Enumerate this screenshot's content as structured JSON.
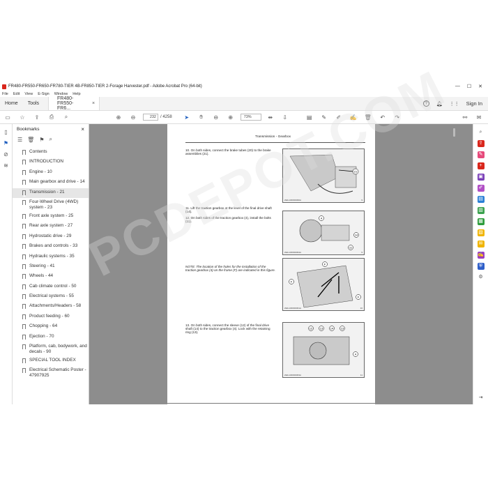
{
  "window": {
    "title": "FR480-FR550-FR650-FR780-TIER 4B-FR850-TIER 2-Forage Harvester.pdf - Adobe Acrobat Pro (64-bit)",
    "controls": [
      "—",
      "☐",
      "✕"
    ]
  },
  "menu": [
    "File",
    "Edit",
    "View",
    "E-Sign",
    "Window",
    "Help"
  ],
  "tabs": {
    "home": "Home",
    "tools": "Tools",
    "document": "FR480-FR550-FR6...",
    "close": "×",
    "help": "?",
    "sign_in": "Sign In"
  },
  "toolbar": {
    "page_current": "232",
    "page_total": "/ 4258",
    "zoom": "73%"
  },
  "bookmarks": {
    "title": "Bookmarks",
    "close": "×",
    "selected_index": 4,
    "items": [
      "Contents",
      "INTRODUCTION",
      "Engine - 10",
      "Main gearbox and drive - 14",
      "Transmission - 21",
      "Four-Wheel Drive (4WD) system - 23",
      "Front axle system - 25",
      "Rear axle system - 27",
      "Hydrostatic drive - 29",
      "Brakes and controls - 33",
      "Hydraulic systems - 35",
      "Steering - 41",
      "Wheels - 44",
      "Cab climate control - 50",
      "Electrical systems - 55",
      "Attachments/Headers - 58",
      "Product feeding - 60",
      "Chopping - 64",
      "Ejection - 70",
      "Platform, cab, bodywork, and decals - 90",
      "SPECIAL TOOL INDEX",
      "Electrical Schematic Poster - 47907925"
    ]
  },
  "document": {
    "header": "Transmission - Gearbox",
    "steps": [
      {
        "text": "10.  On both sides, connect the brake tubes (20) to the brake assemblies (21).",
        "fig_code": "ZEIL13FR00060A",
        "fig_num": "9"
      },
      {
        "text": "11.  Lift the traction gearbox at the level of the final drive shaft (14).",
        "fig_code": "",
        "fig_num": ""
      },
      {
        "text": "12.  On both sides of the traction gearbox (4), install the bolts (11).",
        "fig_code": "ZEIL13FR00064A",
        "fig_num": "9"
      },
      {
        "text": "NOTE: The location of the holes for the installation of the traction gearbox (4) on the frame (F) are indicated in this figure.",
        "fig_code": "ZEIL13FR00061A",
        "fig_num": "10"
      },
      {
        "text": "13.  On both sides, connect the sleeve (12) of the final drive shaft (14) to the traction gearbox (4). Lock with the retaining ring (13).",
        "fig_code": "ZEIL13FR00063A",
        "fig_num": "11"
      }
    ],
    "callouts": {
      "fig1": [
        "21"
      ],
      "fig2": [
        "4",
        "14",
        "11"
      ],
      "fig3": [
        "F",
        "F",
        "F"
      ],
      "fig4": [
        "12",
        "13",
        "14",
        "13",
        "4"
      ]
    }
  },
  "watermark": "PCDEPOT.COM",
  "colors": {
    "pdf_red": "#d9261c",
    "viewer_bg": "#8d8d8d"
  }
}
